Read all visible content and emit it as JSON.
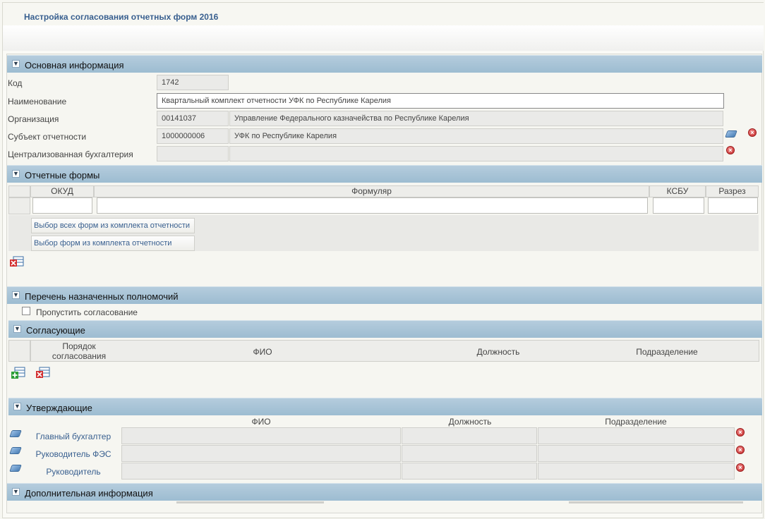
{
  "page": {
    "title": "Настройка согласования отчетных форм 2016"
  },
  "main_info": {
    "header": "Основная информация",
    "code_label": "Код",
    "code_value": "1742",
    "name_label": "Наименование",
    "name_value": "Квартальный комплект отчетности УФК по Республике Карелия",
    "org_label": "Организация",
    "org_code": "00141037",
    "org_name": "Управление Федерального казначейства по Республике Карелия",
    "subject_label": "Субъект отчетности",
    "subject_code": "1000000006",
    "subject_name": "УФК по Республике Карелия",
    "central_label": "Централизованная бухгалтерия",
    "central_code": "",
    "central_name": ""
  },
  "forms": {
    "header": "Отчетные формы",
    "columns": [
      "ОКУД",
      "Формуляр",
      "КСБУ",
      "Разрез"
    ],
    "btn_all": "Выбор всех форм из комплекта отчетности",
    "btn_select": "Выбор форм из комплекта отчетности"
  },
  "powers": {
    "header": "Перечень назначенных полномочий",
    "skip_label": "Пропустить согласование"
  },
  "approvers": {
    "header": "Согласующие",
    "columns": [
      "Порядок согласования",
      "ФИО",
      "Должность",
      "Подразделение"
    ]
  },
  "confirmers": {
    "header": "Утверждающие",
    "columns": [
      "ФИО",
      "Должность",
      "Подразделение"
    ],
    "rows": [
      {
        "role": "Главный бухгалтер",
        "fio": "",
        "position": "",
        "department": ""
      },
      {
        "role": "Руководитель ФЭС",
        "fio": "",
        "position": "",
        "department": ""
      },
      {
        "role": "Руководитель",
        "fio": "",
        "position": "",
        "department": ""
      }
    ]
  },
  "additional": {
    "header": "Дополнительная информация"
  },
  "icons": {
    "collapse": "chevron-down-icon",
    "edit": "book-icon",
    "remove": "remove-icon",
    "delete_row": "delete-row-icon",
    "add_row": "add-row-icon"
  }
}
